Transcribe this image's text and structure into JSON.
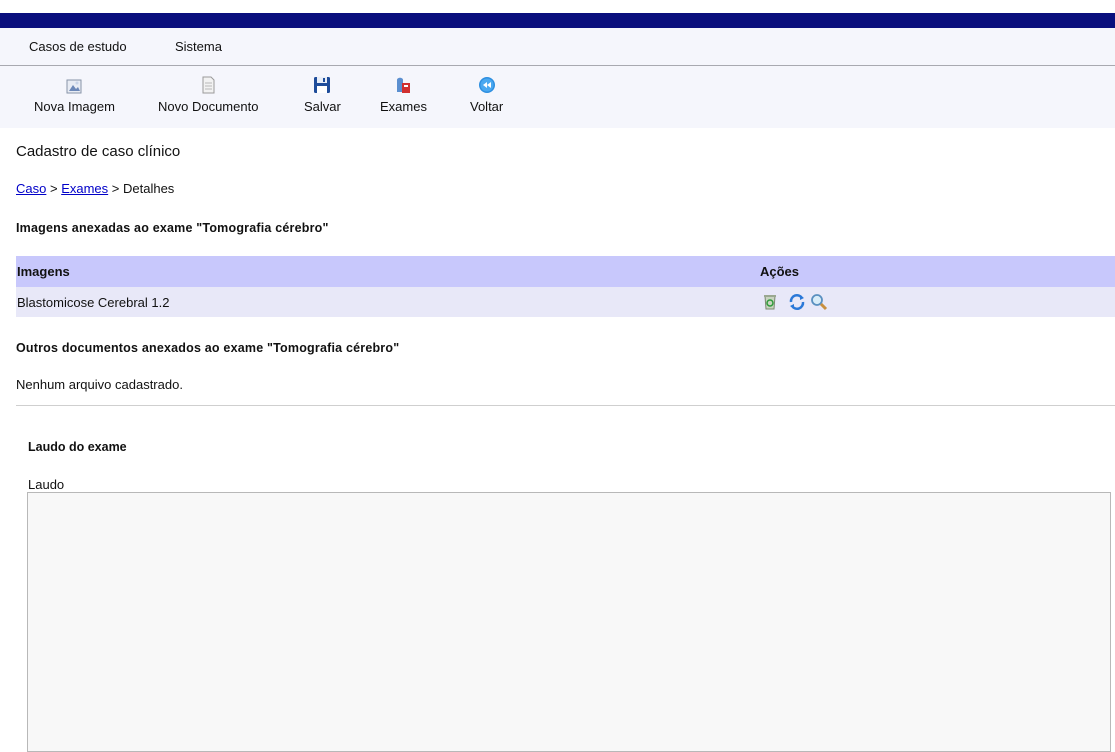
{
  "menu": {
    "items": [
      {
        "label": "Casos de estudo"
      },
      {
        "label": "Sistema"
      }
    ]
  },
  "toolbar": {
    "buttons": [
      {
        "label": "Nova Imagem",
        "icon": "new-image-icon"
      },
      {
        "label": "Novo Documento",
        "icon": "new-document-icon"
      },
      {
        "label": "Salvar",
        "icon": "floppy-disk-icon"
      },
      {
        "label": "Exames",
        "icon": "exams-icon"
      },
      {
        "label": "Voltar",
        "icon": "rewind-back-icon"
      }
    ]
  },
  "page": {
    "title": "Cadastro de caso clínico",
    "breadcrumb": {
      "link1": "Caso",
      "sep1": " > ",
      "link2": "Exames",
      "sep2": " > ",
      "current": "Detalhes"
    }
  },
  "images_section": {
    "title": "Imagens anexadas ao exame \"Tomografia cérebro\"",
    "col_images": "Imagens",
    "col_actions": "Ações",
    "rows": [
      {
        "name": "Blastomicose Cerebral 1.2",
        "actions": [
          "recycle-bin-icon",
          "refresh-icon",
          "magnifier-icon"
        ]
      }
    ]
  },
  "documents_section": {
    "title": "Outros documentos anexados ao exame \"Tomografia cérebro\"",
    "empty_message": "Nenhum arquivo cadastrado."
  },
  "report": {
    "title": "Laudo do exame",
    "field_label": "Laudo",
    "value": ""
  },
  "colors": {
    "top_bar": "#0a0f7d",
    "table_header": "#c8c8fc",
    "table_row": "#e8e8f8",
    "link": "#0000c8"
  }
}
